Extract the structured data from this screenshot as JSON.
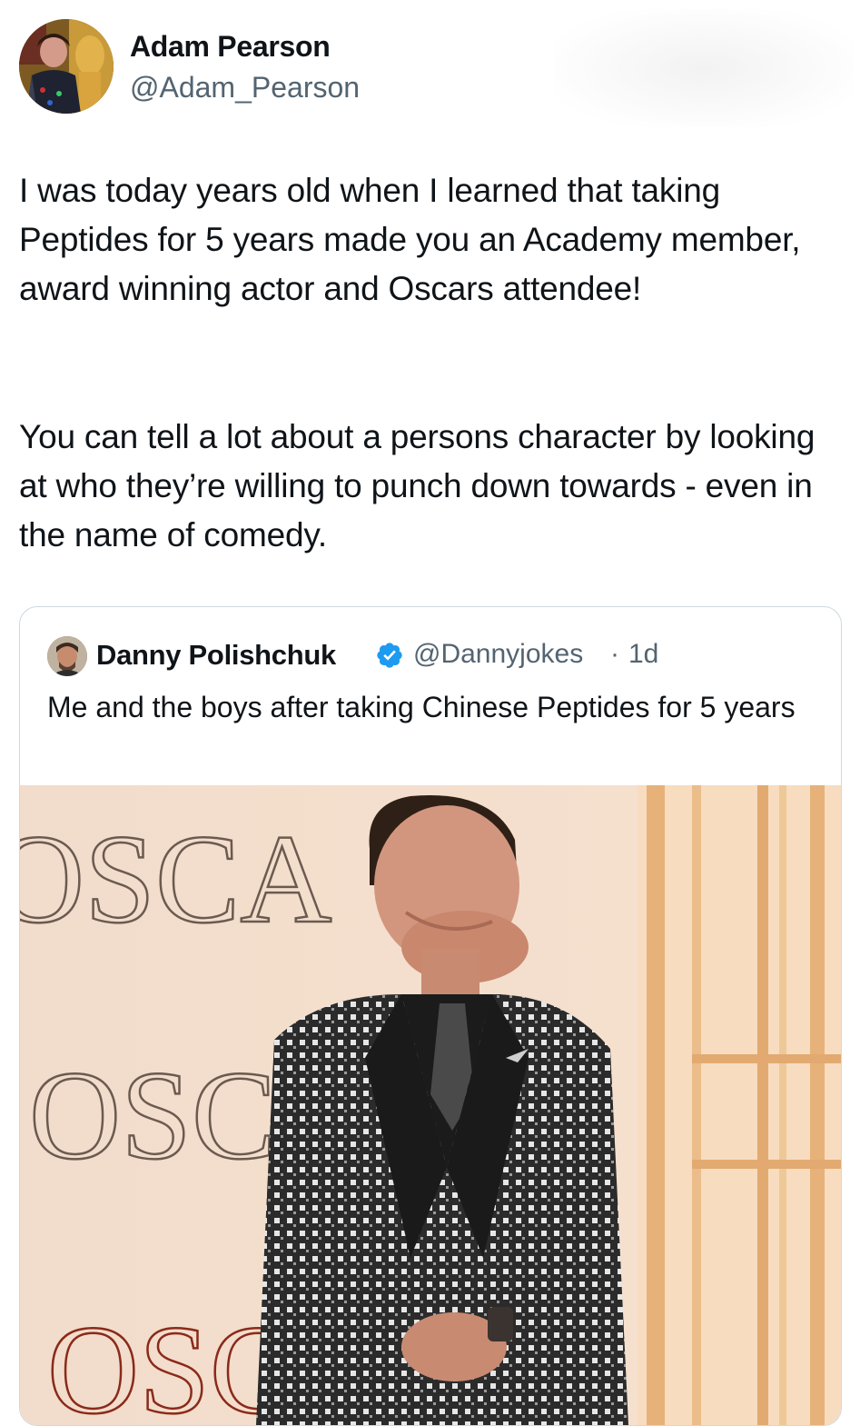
{
  "tweet": {
    "author_name": "Adam Pearson",
    "author_handle": "@Adam_Pearson",
    "paragraphs": [
      "I was today years old when I learned that taking Peptides for 5 years made you an Academy member, award winning actor and Oscars attendee!",
      "You can tell a lot about a persons character by looking at who they’re willing to punch down towards - even in the name of comedy."
    ]
  },
  "quoted_tweet": {
    "author_name": "Danny Polishchuk",
    "author_handle": "@Dannyjokes",
    "separator": "·",
    "time": "1d",
    "verified": true,
    "text": "Me and the boys after taking Chinese Peptides for  5 years",
    "media": {
      "backdrop_text": [
        "OSCA",
        "OSC",
        "OSC"
      ],
      "colors": {
        "backdrop": "#f4dcc6",
        "wall_stripes": "#e8b888",
        "jacket": "#2a2a2a"
      }
    }
  },
  "colors": {
    "text": "#0f1419",
    "secondary": "#536471",
    "border": "#cfd9de",
    "verified": "#1d9bf0"
  },
  "icons": {
    "verified": "verified-badge-icon"
  }
}
